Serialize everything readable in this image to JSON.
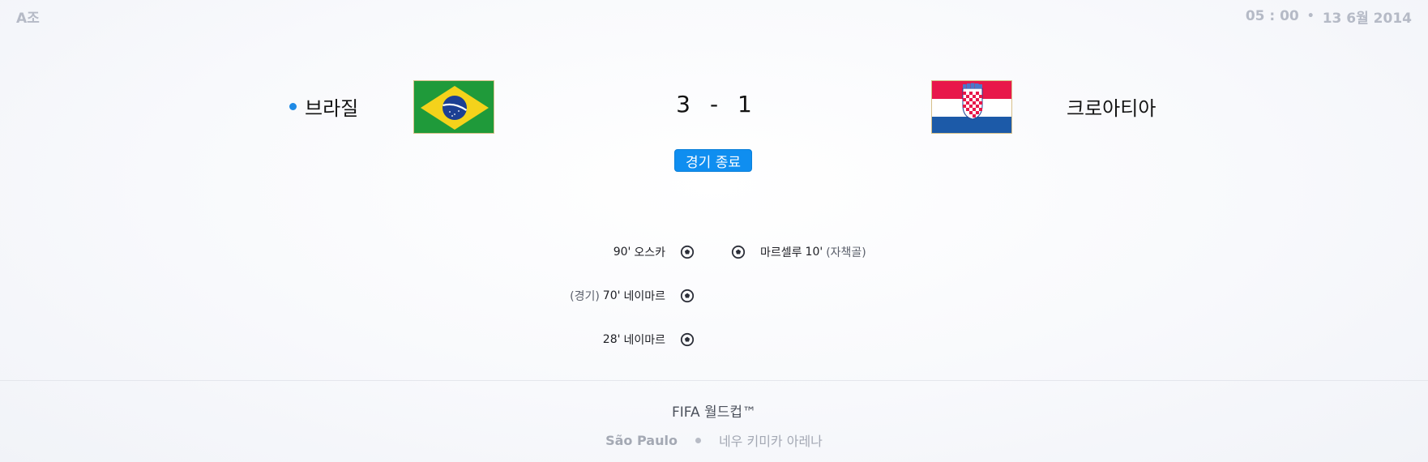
{
  "match": {
    "group": "A조",
    "time": "05 : 00",
    "separator": "•",
    "date": "13 6월 2014",
    "home_team": "브라질",
    "away_team": "크로아티아",
    "home_score": "3",
    "score_separator": "-",
    "away_score": "1",
    "status": "경기 종료",
    "home_flag_icon": "brazil-flag-icon",
    "away_flag_icon": "croatia-flag-icon",
    "colors": {
      "status_bg": "#0f8ef0",
      "live_dot": "#1f8ae5"
    }
  },
  "events": {
    "home": [
      {
        "minute": "90'",
        "player": "오스카",
        "note": ""
      },
      {
        "minute": "70'",
        "player": "네이마르",
        "note": "(경기)"
      },
      {
        "minute": "28'",
        "player": "네이마르",
        "note": ""
      }
    ],
    "away": [
      {
        "player": "마르셀루",
        "minute": "10'",
        "note": "(자책골)"
      }
    ],
    "event_icon": "soccer-ball-icon"
  },
  "footer": {
    "competition": "FIFA 월드컵™",
    "city": "São Paulo",
    "stadium": "네우 키미카 아레나"
  }
}
